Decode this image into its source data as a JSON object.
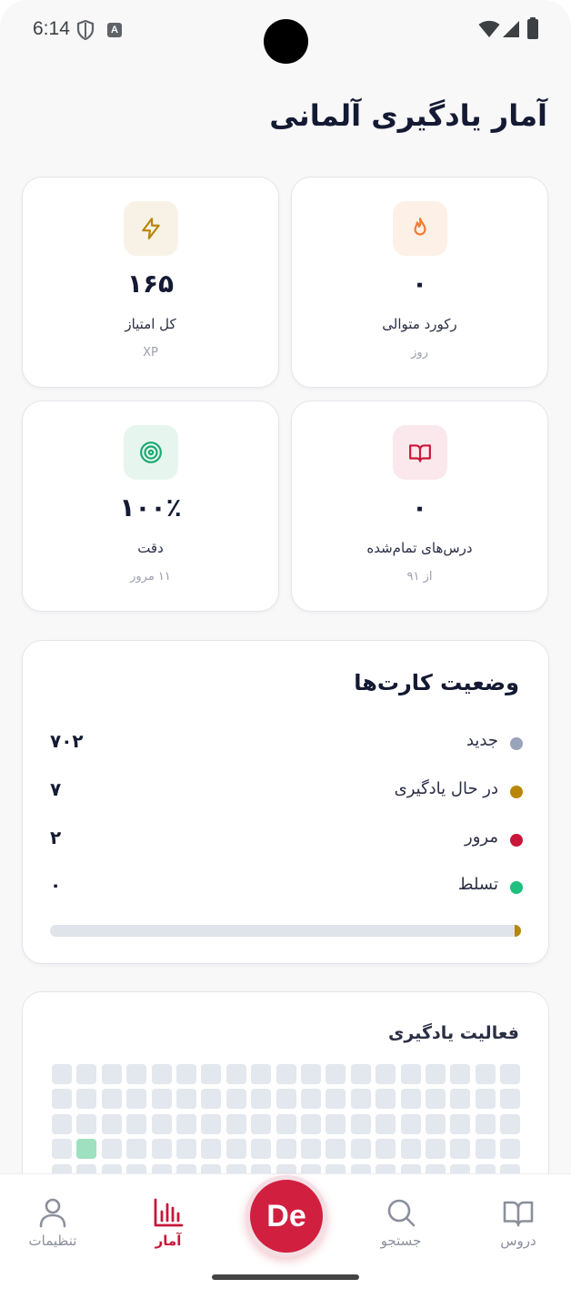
{
  "status_bar": {
    "time": "6:14",
    "indicator_letter": "A"
  },
  "page_title": "آمار یادگیری آلمانی",
  "stats": [
    {
      "id": "streak",
      "value": "۰",
      "label": "رکورد متوالی",
      "sub": "روز",
      "icon": "flame-icon",
      "icon_color": "#f07a2e",
      "icon_bg": "#fdf0e6"
    },
    {
      "id": "xp",
      "value": "۱۶۵",
      "label": "کل امتیاز",
      "sub": "XP",
      "icon": "lightning-icon",
      "icon_color": "#b8860b",
      "icon_bg": "#f8f2e6"
    },
    {
      "id": "lessons",
      "value": "۰",
      "label": "درس‌های تمام‌شده",
      "sub": "از ۹۱",
      "icon": "book-icon",
      "icon_color": "#c8173a",
      "icon_bg": "#fbe8ec"
    },
    {
      "id": "accuracy",
      "value": "۱۰۰٪",
      "label": "دقت",
      "sub": "۱۱ مرور",
      "icon": "target-icon",
      "icon_color": "#1aa971",
      "icon_bg": "#e6f6ef"
    }
  ],
  "card_status": {
    "title": "وضعیت کارت‌ها",
    "rows": [
      {
        "label": "جدید",
        "count": "۷۰۲",
        "color": "#9aa3ba"
      },
      {
        "label": "در حال یادگیری",
        "count": "۷",
        "color": "#b8860b"
      },
      {
        "label": "مرور",
        "count": "۲",
        "color": "#c8173a"
      },
      {
        "label": "تسلط",
        "count": "۰",
        "color": "#1fbf7f"
      }
    ],
    "progress_learning_fraction": 0.013
  },
  "activity": {
    "title": "فعالیت یادگیری",
    "highlight_color": "#9ee0bf",
    "cell_color": "#e3e7ee"
  },
  "nav": {
    "items": [
      {
        "id": "lessons",
        "label": "دروس",
        "icon": "book-icon",
        "active": false
      },
      {
        "id": "search",
        "label": "جستجو",
        "icon": "search-icon",
        "active": false
      },
      {
        "id": "stats",
        "label": "آمار",
        "icon": "bar-chart-icon",
        "active": true
      },
      {
        "id": "settings",
        "label": "تنظیمات",
        "icon": "user-icon",
        "active": false
      }
    ],
    "fab_label": "De"
  }
}
